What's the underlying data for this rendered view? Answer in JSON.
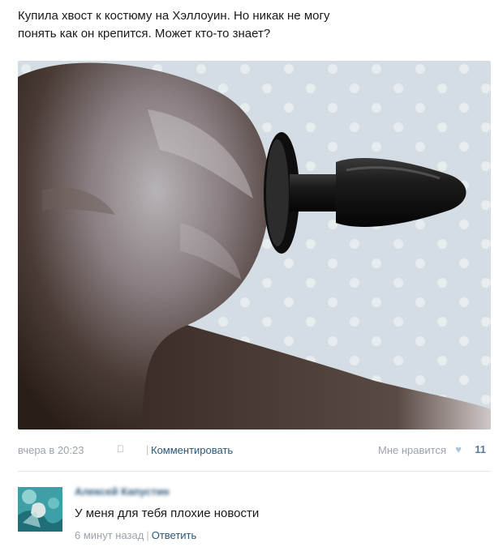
{
  "post": {
    "text": "Купила хвост к костюму на Хэллоуин. Но никак не могу\nпонять как он крепится. Может кто-то знает?",
    "date": "вчера в 20:23",
    "device_icon": "apple-icon",
    "comment_link": "Комментировать",
    "like_label": "Мне нравится",
    "like_count": "11",
    "like_icon": "heart-icon"
  },
  "comment": {
    "author": "Алексей Капустин",
    "text": "У меня для тебя плохие новости",
    "time": "6 минут назад",
    "reply_link": "Ответить"
  },
  "colors": {
    "link": "#2b587a",
    "muted": "#9aa3ad",
    "heart": "#a9c4dd"
  }
}
